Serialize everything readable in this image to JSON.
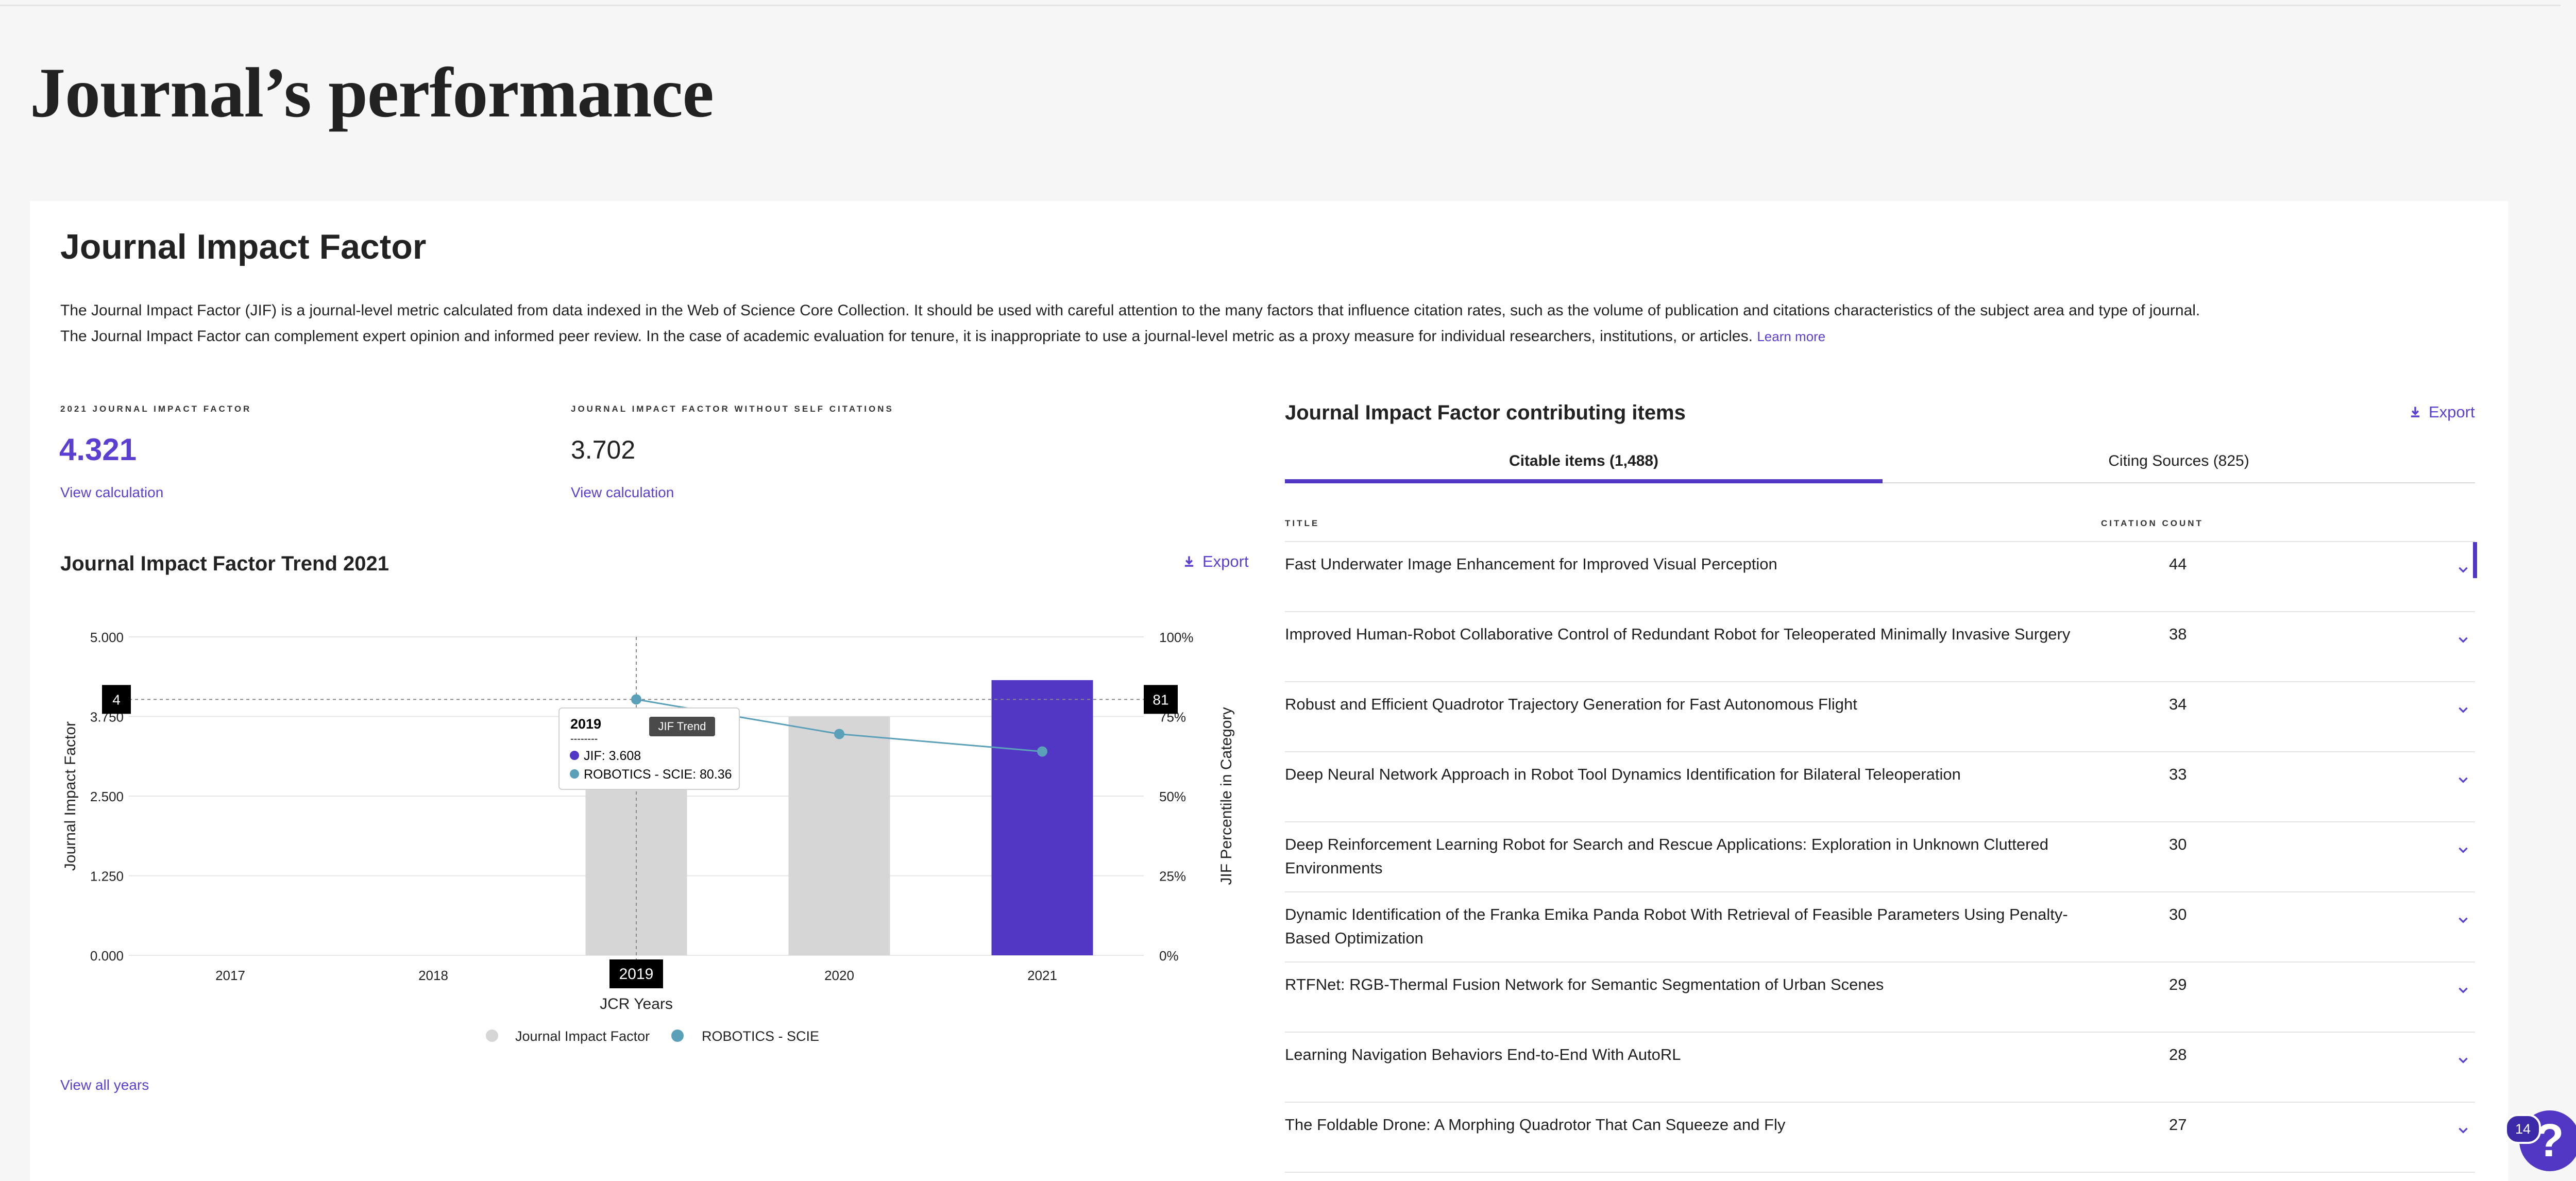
{
  "page": {
    "title": "Journal’s performance"
  },
  "jif": {
    "section_title": "Journal Impact Factor",
    "description": "The Journal Impact Factor (JIF) is a journal-level metric calculated from data indexed in the Web of Science Core Collection. It should be used with careful attention to the many factors that influence citation rates, such as the volume of publication and citations characteristics of the subject area and type of journal. The Journal Impact Factor can complement expert opinion and informed peer review. In the case of academic evaluation for tenure, it is inappropriate to use a journal-level metric as a proxy measure for individual researchers, institutions, or articles.",
    "learn_more": "Learn more",
    "metric_2021": {
      "label": "2021 Journal Impact Factor",
      "value": "4.321",
      "link": "View calculation",
      "color": "#5b3fd1"
    },
    "metric_no_self": {
      "label": "Journal Impact Factor without self citations",
      "value": "3.702",
      "link": "View calculation"
    }
  },
  "trend": {
    "title": "Journal Impact Factor Trend 2021",
    "export_label": "Export",
    "view_all": "View all years"
  },
  "chart_data": {
    "type": "bar",
    "title": "",
    "categories": [
      "2017",
      "2018",
      "2019",
      "2020",
      "2021"
    ],
    "series": [
      {
        "name": "Journal Impact Factor",
        "values": [
          null,
          null,
          3.758,
          3.75,
          4.321
        ],
        "colors": [
          "#d6d6d6",
          "#d6d6d6",
          "#d6d6d6",
          "#d6d6d6",
          "#5237c5"
        ]
      },
      {
        "name": "ROBOTICS - SCIE",
        "type": "line",
        "axis": "right",
        "values": [
          null,
          null,
          80.36,
          69.5,
          64.0
        ],
        "color": "#5aa0b8"
      }
    ],
    "xlabel": "JCR Years",
    "ylabel": "Journal Impact Factor",
    "ylabel_right": "JIF Percentile in Category",
    "ylim": [
      0,
      5
    ],
    "ylim_right": [
      0,
      100
    ],
    "y_ticks": [
      "0.000",
      "1.250",
      "2.500",
      "3.750",
      "5.000"
    ],
    "y_ticks_right": [
      "0%",
      "25%",
      "50%",
      "75%",
      "100%"
    ],
    "legend": [
      "Journal Impact Factor",
      "ROBOTICS - SCIE"
    ],
    "legend_colors": [
      "#d6d6d6",
      "#5aa0b8"
    ],
    "legend_position": "bottom-center",
    "crosshair": {
      "year": "2019",
      "left_badge": "4",
      "right_badge": "81"
    },
    "tooltip": {
      "year": "2019",
      "separator": "--------",
      "jif_line": "JIF: 3.608",
      "robotics_line": "ROBOTICS - SCIE: 80.36",
      "trend_tag": "JIF Trend"
    },
    "grid": true
  },
  "contributing": {
    "title": "Journal Impact Factor contributing items",
    "export_label": "Export",
    "tabs": [
      {
        "label": "Citable items (1,488)",
        "active": true
      },
      {
        "label": "Citing Sources (825)",
        "active": false
      }
    ],
    "col_title": "TITLE",
    "col_count": "CITATION COUNT",
    "rows": [
      {
        "title": "Fast Underwater Image Enhancement for Improved Visual Perception",
        "count": "44"
      },
      {
        "title": "Improved Human-Robot Collaborative Control of Redundant Robot for Teleoperated Minimally Invasive Surgery",
        "count": "38"
      },
      {
        "title": "Robust and Efficient Quadrotor Trajectory Generation for Fast Autonomous Flight",
        "count": "34"
      },
      {
        "title": "Deep Neural Network Approach in Robot Tool Dynamics Identification for Bilateral Teleoperation",
        "count": "33"
      },
      {
        "title": "Deep Reinforcement Learning Robot for Search and Rescue Applications: Exploration in Unknown Cluttered Environments",
        "count": "30"
      },
      {
        "title": "Dynamic Identification of the Franka Emika Panda Robot With Retrieval of Feasible Parameters Using Penalty-Based Optimization",
        "count": "30"
      },
      {
        "title": "RTFNet: RGB-Thermal Fusion Network for Semantic Segmentation of Urban Scenes",
        "count": "29"
      },
      {
        "title": "Learning Navigation Behaviors End-to-End With AutoRL",
        "count": "28"
      },
      {
        "title": "The Foldable Drone: A Morphing Quadrotor That Can Squeeze and Fly",
        "count": "27"
      }
    ]
  },
  "help": {
    "badge": "14",
    "glyph": "?"
  }
}
